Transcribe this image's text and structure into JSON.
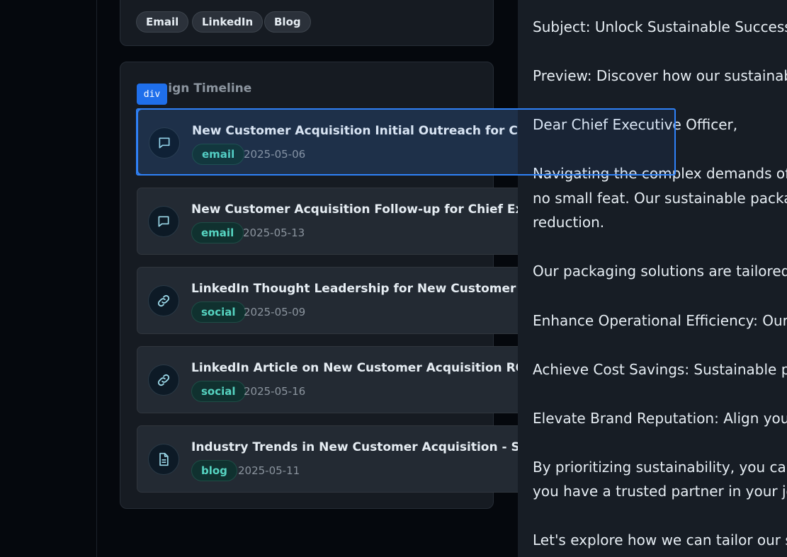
{
  "channels": {
    "chips": [
      "Email",
      "LinkedIn",
      "Blog"
    ]
  },
  "timeline": {
    "title": "Campaign Timeline",
    "inspector_badge": "div",
    "items": [
      {
        "title": "New Customer Acquisition Initial Outreach for Chief Executive Officer",
        "tag": "email",
        "date": "2025-05-06",
        "icon": "message-icon"
      },
      {
        "title": "New Customer Acquisition Follow-up for Chief Executive Officer",
        "tag": "email",
        "date": "2025-05-13",
        "icon": "message-icon"
      },
      {
        "title": "LinkedIn Thought Leadership for New Customer Acquisition",
        "tag": "social",
        "date": "2025-05-09",
        "icon": "link-icon"
      },
      {
        "title": "LinkedIn Article on New Customer Acquisition ROI",
        "tag": "social",
        "date": "2025-05-16",
        "icon": "link-icon"
      },
      {
        "title": "Industry Trends in New Customer Acquisition - Strategy",
        "tag": "blog",
        "date": "2025-05-11",
        "icon": "document-icon"
      }
    ]
  },
  "email": {
    "lines": [
      "Subject: Unlock Sustainable Success in",
      "Preview: Discover how our sustainable",
      "Dear Chief Executive Officer,",
      "Navigating the complex demands of m",
      "no small feat. Our sustainable packagi",
      "reduction.",
      "Our packaging solutions are tailored t",
      "Enhance Operational Efficiency: Our so",
      "Achieve Cost Savings: Sustainable pac",
      "Elevate Brand Reputation: Align your p",
      "By prioritizing sustainability, you can a",
      "you have a trusted partner in your jou",
      "Let's explore how we can tailor our so"
    ]
  },
  "colors": {
    "accent": "#2f81f7",
    "tag_text": "#56d4c1",
    "background": "#05080d"
  }
}
